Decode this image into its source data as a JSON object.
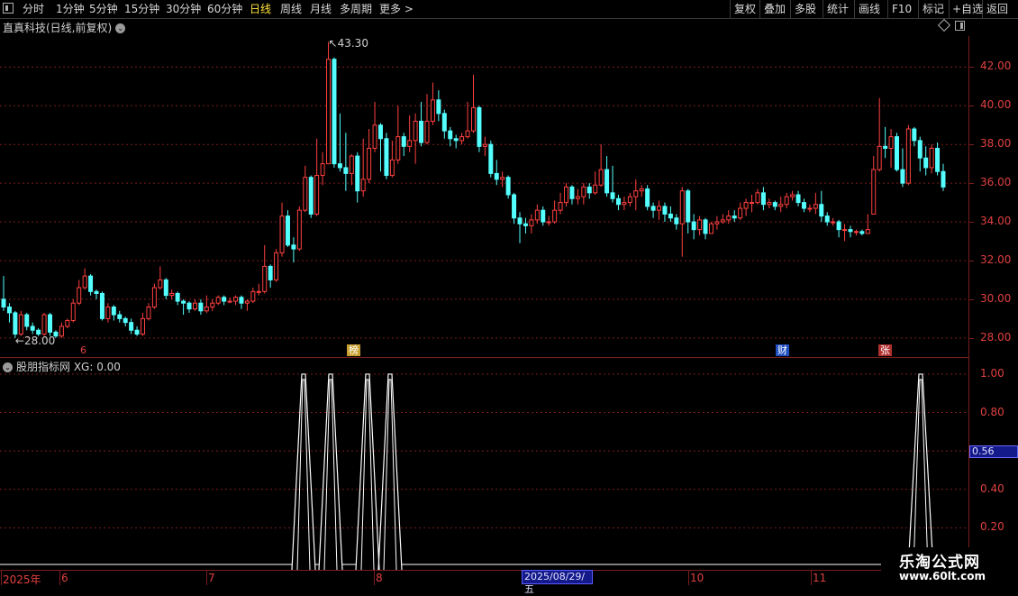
{
  "toolbar": {
    "periods": [
      "分时",
      "1分钟",
      "5分钟",
      "15分钟",
      "30分钟",
      "60分钟",
      "日线",
      "周线",
      "月线",
      "多周期",
      "更多 >"
    ],
    "active_period": "日线",
    "tools": [
      "复权",
      "叠加",
      "多股",
      "统计",
      "画线",
      "F10",
      "标记",
      "+自选",
      "返回"
    ]
  },
  "chart_title": "直真科技(日线,前复权)",
  "main_axis_labels": [
    "42.00",
    "40.00",
    "38.00",
    "36.00",
    "34.00",
    "32.00",
    "30.00",
    "28.00"
  ],
  "high_annotation": "43.30",
  "low_annotation": "28.00",
  "badges": [
    {
      "label": "6",
      "color": "#e04040"
    },
    {
      "label": "榜",
      "color": "#c8a030"
    },
    {
      "label": "财",
      "color": "#2050c0"
    },
    {
      "label": "张",
      "color": "#b03030"
    }
  ],
  "indicator_title": "股朋指标网 XG: 0.00",
  "indicator_axis_labels": [
    "1.00",
    "0.80",
    "0.40",
    "0.20"
  ],
  "indicator_current": "0.56",
  "date_axis": [
    "2025年",
    "6",
    "7",
    "8",
    "10",
    "11"
  ],
  "date_highlight": "2025/08/29/五",
  "watermark": {
    "line1": "乐淘公式网",
    "line2": "www.60lt.com"
  },
  "colors": {
    "up": "#ff4040",
    "down": "#54ffff",
    "grid": "#7a1d1d",
    "signal": "#ffffff"
  },
  "chart_data": {
    "type": "candlestick",
    "ylim": [
      27.2,
      43.6
    ],
    "candles": [
      [
        30.0,
        29.6,
        31.2,
        29.4
      ],
      [
        29.6,
        29.3,
        29.8,
        28.8
      ],
      [
        29.3,
        28.2,
        29.4,
        28.0
      ],
      [
        28.2,
        29.2,
        29.4,
        28.1
      ],
      [
        29.2,
        28.6,
        29.3,
        28.4
      ],
      [
        28.6,
        28.4,
        28.8,
        28.2
      ],
      [
        28.4,
        28.2,
        28.5,
        28.1
      ],
      [
        28.2,
        29.2,
        29.3,
        28.1
      ],
      [
        29.2,
        28.3,
        29.3,
        28.1
      ],
      [
        28.3,
        28.1,
        28.4,
        28.0
      ],
      [
        28.1,
        28.6,
        28.8,
        28.0
      ],
      [
        28.6,
        28.9,
        29.0,
        28.5
      ],
      [
        28.9,
        29.8,
        30.0,
        28.8
      ],
      [
        29.8,
        30.6,
        31.0,
        29.7
      ],
      [
        30.6,
        31.2,
        31.6,
        30.5
      ],
      [
        31.2,
        30.4,
        31.3,
        30.2
      ],
      [
        30.4,
        30.3,
        30.5,
        30.0
      ],
      [
        30.3,
        29.0,
        30.4,
        28.9
      ],
      [
        29.0,
        29.6,
        29.8,
        28.8
      ],
      [
        29.6,
        29.2,
        29.7,
        28.9
      ],
      [
        29.2,
        29.0,
        29.4,
        28.8
      ],
      [
        29.0,
        28.8,
        29.1,
        28.6
      ],
      [
        28.8,
        28.4,
        29.0,
        28.2
      ],
      [
        28.4,
        28.2,
        28.6,
        28.1
      ],
      [
        28.2,
        29.0,
        29.3,
        28.1
      ],
      [
        29.0,
        29.6,
        29.8,
        28.9
      ],
      [
        29.6,
        30.6,
        30.8,
        29.5
      ],
      [
        30.6,
        31.0,
        31.7,
        30.5
      ],
      [
        31.0,
        30.2,
        31.1,
        30.0
      ],
      [
        30.2,
        30.3,
        30.5,
        30.0
      ],
      [
        30.3,
        29.9,
        30.4,
        29.7
      ],
      [
        29.9,
        29.8,
        30.0,
        29.2
      ],
      [
        29.8,
        29.5,
        29.9,
        29.3
      ],
      [
        29.5,
        29.8,
        30.0,
        29.4
      ],
      [
        29.8,
        29.4,
        30.0,
        29.2
      ],
      [
        29.4,
        29.6,
        30.2,
        29.3
      ],
      [
        29.6,
        29.8,
        30.0,
        29.4
      ],
      [
        29.8,
        30.1,
        30.2,
        29.7
      ],
      [
        30.1,
        29.9,
        30.2,
        29.7
      ],
      [
        29.9,
        29.9,
        30.1,
        29.8
      ],
      [
        29.9,
        30.1,
        30.2,
        29.7
      ],
      [
        30.1,
        29.8,
        30.2,
        29.5
      ],
      [
        29.8,
        29.9,
        30.0,
        29.4
      ],
      [
        29.9,
        30.4,
        30.6,
        29.8
      ],
      [
        30.4,
        30.4,
        30.8,
        30.2
      ],
      [
        30.4,
        31.7,
        32.8,
        30.3
      ],
      [
        31.7,
        31.0,
        31.8,
        30.6
      ],
      [
        31.0,
        32.4,
        32.6,
        30.9
      ],
      [
        32.4,
        34.3,
        35.0,
        32.2
      ],
      [
        34.3,
        32.8,
        34.6,
        32.7
      ],
      [
        32.8,
        32.6,
        33.2,
        31.9
      ],
      [
        32.6,
        34.6,
        34.8,
        32.5
      ],
      [
        34.6,
        36.3,
        36.9,
        34.5
      ],
      [
        36.3,
        34.4,
        36.4,
        34.2
      ],
      [
        34.4,
        36.4,
        38.3,
        34.3
      ],
      [
        36.4,
        37.0,
        37.6,
        35.9
      ],
      [
        37.0,
        42.4,
        43.3,
        40.0
      ],
      [
        42.4,
        37.0,
        42.5,
        36.8
      ],
      [
        37.0,
        36.8,
        39.6,
        36.6
      ],
      [
        36.8,
        36.5,
        38.6,
        35.6
      ],
      [
        36.5,
        37.4,
        37.5,
        35.9
      ],
      [
        37.4,
        35.6,
        37.6,
        35.0
      ],
      [
        35.6,
        36.2,
        38.3,
        35.3
      ],
      [
        36.2,
        37.8,
        38.8,
        36.0
      ],
      [
        37.8,
        39.0,
        40.2,
        37.6
      ],
      [
        39.0,
        38.3,
        39.1,
        36.6
      ],
      [
        38.3,
        36.4,
        38.6,
        36.2
      ],
      [
        36.4,
        37.2,
        38.2,
        36.3
      ],
      [
        37.2,
        38.4,
        40.0,
        37.0
      ],
      [
        38.4,
        37.9,
        38.6,
        37.4
      ],
      [
        37.9,
        38.2,
        39.5,
        37.6
      ],
      [
        38.2,
        39.2,
        39.6,
        37.0
      ],
      [
        39.2,
        38.1,
        40.2,
        37.9
      ],
      [
        38.1,
        39.2,
        40.6,
        38.0
      ],
      [
        39.2,
        40.3,
        41.2,
        39.0
      ],
      [
        40.3,
        39.6,
        40.8,
        39.2
      ],
      [
        39.6,
        38.7,
        39.8,
        38.3
      ],
      [
        38.7,
        38.3,
        38.9,
        37.9
      ],
      [
        38.3,
        38.2,
        38.5,
        37.8
      ],
      [
        38.2,
        38.4,
        38.6,
        38.0
      ],
      [
        38.4,
        38.7,
        40.2,
        38.3
      ],
      [
        38.7,
        39.9,
        41.6,
        38.6
      ],
      [
        39.9,
        37.9,
        40.0,
        37.6
      ],
      [
        37.9,
        38.0,
        38.4,
        37.4
      ],
      [
        38.0,
        36.5,
        38.2,
        36.3
      ],
      [
        36.5,
        36.2,
        37.2,
        35.9
      ],
      [
        36.2,
        36.3,
        36.6,
        35.8
      ],
      [
        36.3,
        35.4,
        36.4,
        35.2
      ],
      [
        35.4,
        34.2,
        35.5,
        33.9
      ],
      [
        34.2,
        33.9,
        34.5,
        32.9
      ],
      [
        33.9,
        33.8,
        34.2,
        33.4
      ],
      [
        33.8,
        34.1,
        34.4,
        33.4
      ],
      [
        34.1,
        34.6,
        34.9,
        33.9
      ],
      [
        34.6,
        34.0,
        34.8,
        33.8
      ],
      [
        34.0,
        34.0,
        34.3,
        33.8
      ],
      [
        34.0,
        34.6,
        35.1,
        33.9
      ],
      [
        34.6,
        35.0,
        35.5,
        34.4
      ],
      [
        35.0,
        35.8,
        36.0,
        34.8
      ],
      [
        35.8,
        35.2,
        35.9,
        34.9
      ],
      [
        35.2,
        35.3,
        35.7,
        34.9
      ],
      [
        35.3,
        35.8,
        36.0,
        34.9
      ],
      [
        35.8,
        35.5,
        36.0,
        35.2
      ],
      [
        35.5,
        35.9,
        36.6,
        35.4
      ],
      [
        35.9,
        36.7,
        38.0,
        35.8
      ],
      [
        36.7,
        35.5,
        37.4,
        35.3
      ],
      [
        35.5,
        35.2,
        36.9,
        35.0
      ],
      [
        35.2,
        34.9,
        35.4,
        34.6
      ],
      [
        34.9,
        35.0,
        35.3,
        34.6
      ],
      [
        35.0,
        35.3,
        35.5,
        34.8
      ],
      [
        35.3,
        35.6,
        36.2,
        34.6
      ],
      [
        35.6,
        35.7,
        35.9,
        35.3
      ],
      [
        35.7,
        34.8,
        35.9,
        34.6
      ],
      [
        34.8,
        34.6,
        35.0,
        34.2
      ],
      [
        34.6,
        34.8,
        35.1,
        34.1
      ],
      [
        34.8,
        34.4,
        35.0,
        34.0
      ],
      [
        34.4,
        34.2,
        34.8,
        34.0
      ],
      [
        34.2,
        33.9,
        34.4,
        33.6
      ],
      [
        33.9,
        35.6,
        35.8,
        32.2
      ],
      [
        35.6,
        34.0,
        35.7,
        33.4
      ],
      [
        34.0,
        33.6,
        34.4,
        33.1
      ],
      [
        33.6,
        34.1,
        34.3,
        33.3
      ],
      [
        34.1,
        33.4,
        34.2,
        33.1
      ],
      [
        33.4,
        33.9,
        34.0,
        33.4
      ],
      [
        33.9,
        34.0,
        34.3,
        33.6
      ],
      [
        34.0,
        34.1,
        34.4,
        33.9
      ],
      [
        34.1,
        34.3,
        34.6,
        33.9
      ],
      [
        34.3,
        34.2,
        34.6,
        34.0
      ],
      [
        34.2,
        34.7,
        35.0,
        34.1
      ],
      [
        34.7,
        35.0,
        35.2,
        34.3
      ],
      [
        35.0,
        35.0,
        35.4,
        34.5
      ],
      [
        35.0,
        35.5,
        35.7,
        34.9
      ],
      [
        35.5,
        34.9,
        35.8,
        34.6
      ],
      [
        34.9,
        35.0,
        35.2,
        34.7
      ],
      [
        35.0,
        34.8,
        35.1,
        34.6
      ],
      [
        34.8,
        34.9,
        35.3,
        34.5
      ],
      [
        34.9,
        35.3,
        35.5,
        34.7
      ],
      [
        35.3,
        35.4,
        35.6,
        35.1
      ],
      [
        35.4,
        35.0,
        35.6,
        34.8
      ],
      [
        35.0,
        34.7,
        35.2,
        34.5
      ],
      [
        34.7,
        34.7,
        34.9,
        34.5
      ],
      [
        34.7,
        34.9,
        35.5,
        34.4
      ],
      [
        34.9,
        34.3,
        35.6,
        34.0
      ],
      [
        34.3,
        34.0,
        34.5,
        33.8
      ],
      [
        34.0,
        34.0,
        34.2,
        33.8
      ],
      [
        34.0,
        33.6,
        34.1,
        33.2
      ],
      [
        33.6,
        33.6,
        33.9,
        33.0
      ],
      [
        33.6,
        33.5,
        33.8,
        33.2
      ],
      [
        33.5,
        33.5,
        33.6,
        33.3
      ],
      [
        33.5,
        33.4,
        33.6,
        33.3
      ],
      [
        33.4,
        33.6,
        34.4,
        33.4
      ],
      [
        34.4,
        36.7,
        37.4,
        34.4
      ],
      [
        36.7,
        37.9,
        40.4,
        36.6
      ],
      [
        37.9,
        37.8,
        38.9,
        37.3
      ],
      [
        37.8,
        38.4,
        38.8,
        36.8
      ],
      [
        38.4,
        36.7,
        38.6,
        36.6
      ],
      [
        36.7,
        36.0,
        37.8,
        35.8
      ],
      [
        36.0,
        38.8,
        39.0,
        35.9
      ],
      [
        38.8,
        38.2,
        38.9,
        37.9
      ],
      [
        38.2,
        37.3,
        38.4,
        36.6
      ],
      [
        37.3,
        36.8,
        37.9,
        36.4
      ],
      [
        36.8,
        37.8,
        38.0,
        36.5
      ],
      [
        37.8,
        36.6,
        38.1,
        36.4
      ],
      [
        36.6,
        35.8,
        37.0,
        35.6
      ]
    ],
    "signals": [
      [
        330,
        344,
        1.0
      ],
      [
        360,
        374,
        1.0
      ],
      [
        401,
        415,
        1.0
      ],
      [
        426,
        440,
        1.0
      ],
      [
        1014,
        1030,
        1.0
      ]
    ],
    "indicator_ylim": [
      0.0,
      1.07
    ]
  }
}
